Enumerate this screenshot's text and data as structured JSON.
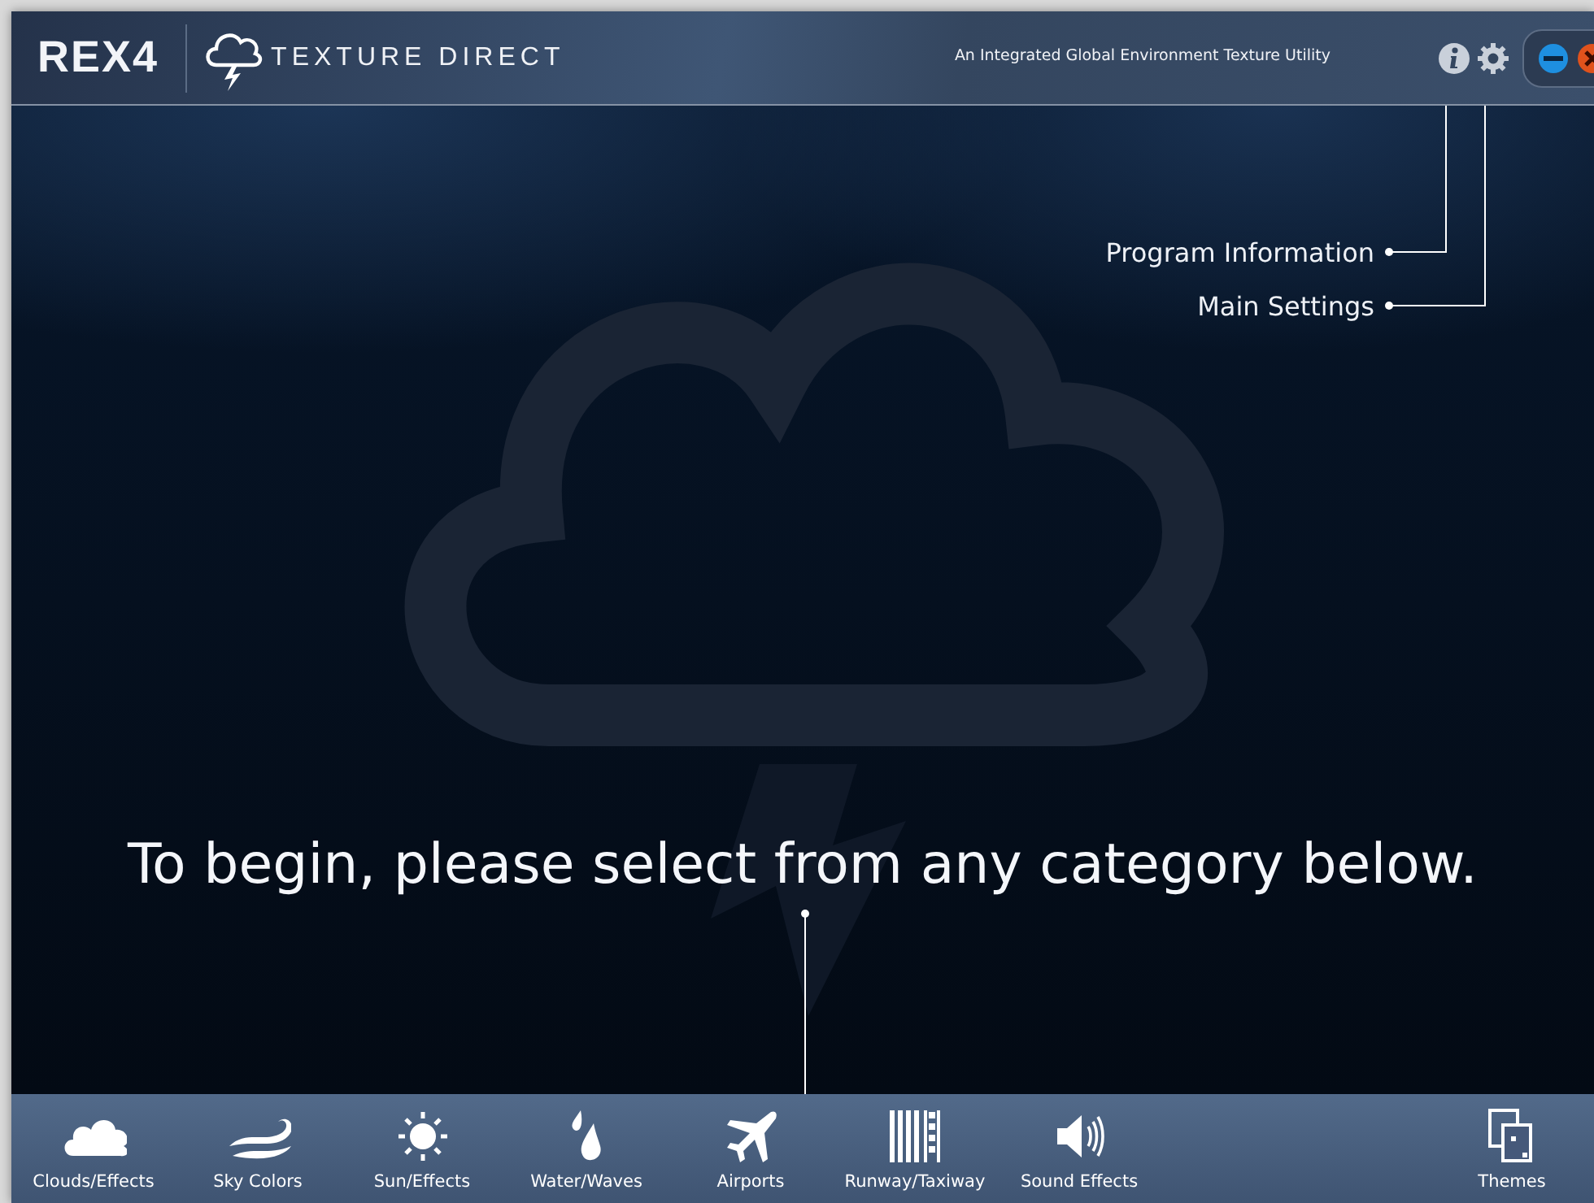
{
  "header": {
    "logo": "REX4",
    "product": "TEXTURE DIRECT",
    "tagline": "An Integrated Global Environment Texture Utility"
  },
  "header_buttons": [
    {
      "kind": "info"
    },
    {
      "kind": "settings"
    }
  ],
  "callouts": [
    {
      "label": "Program Information"
    },
    {
      "label": "Main Settings"
    }
  ],
  "prompt": "To begin, please select from any category below.",
  "categories": [
    {
      "kind": "clouds",
      "label": "Clouds/Effects"
    },
    {
      "kind": "sky",
      "label": "Sky Colors"
    },
    {
      "kind": "sun",
      "label": "Sun/Effects"
    },
    {
      "kind": "water",
      "label": "Water/Waves"
    },
    {
      "kind": "airports",
      "label": "Airports"
    },
    {
      "kind": "runway",
      "label": "Runway/Taxiway"
    },
    {
      "kind": "sound",
      "label": "Sound Effects"
    }
  ],
  "themes": {
    "label": "Themes"
  }
}
